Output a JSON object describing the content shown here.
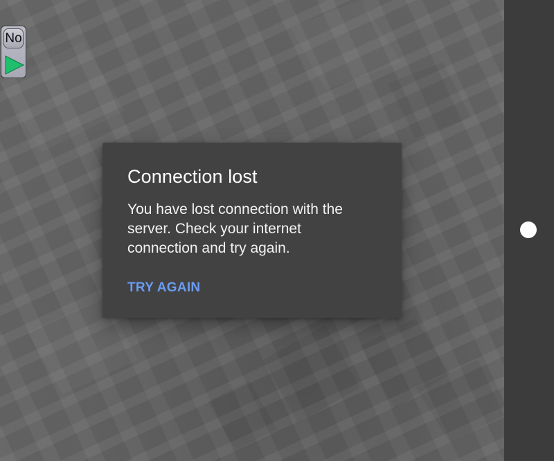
{
  "dialog": {
    "title": "Connection lost",
    "message": "You have lost connection with the server. Check your internet connection and try again.",
    "action_label": "TRY AGAIN"
  },
  "toolbar": {
    "no_label": "No",
    "play_icon": "play-icon"
  },
  "side_panel": {
    "handle_icon": "circle-handle"
  },
  "colors": {
    "dialog_bg": "#424242",
    "action": "#6a9cf2",
    "play": "#1fbf6e",
    "side_panel": "#3c3c3c"
  }
}
